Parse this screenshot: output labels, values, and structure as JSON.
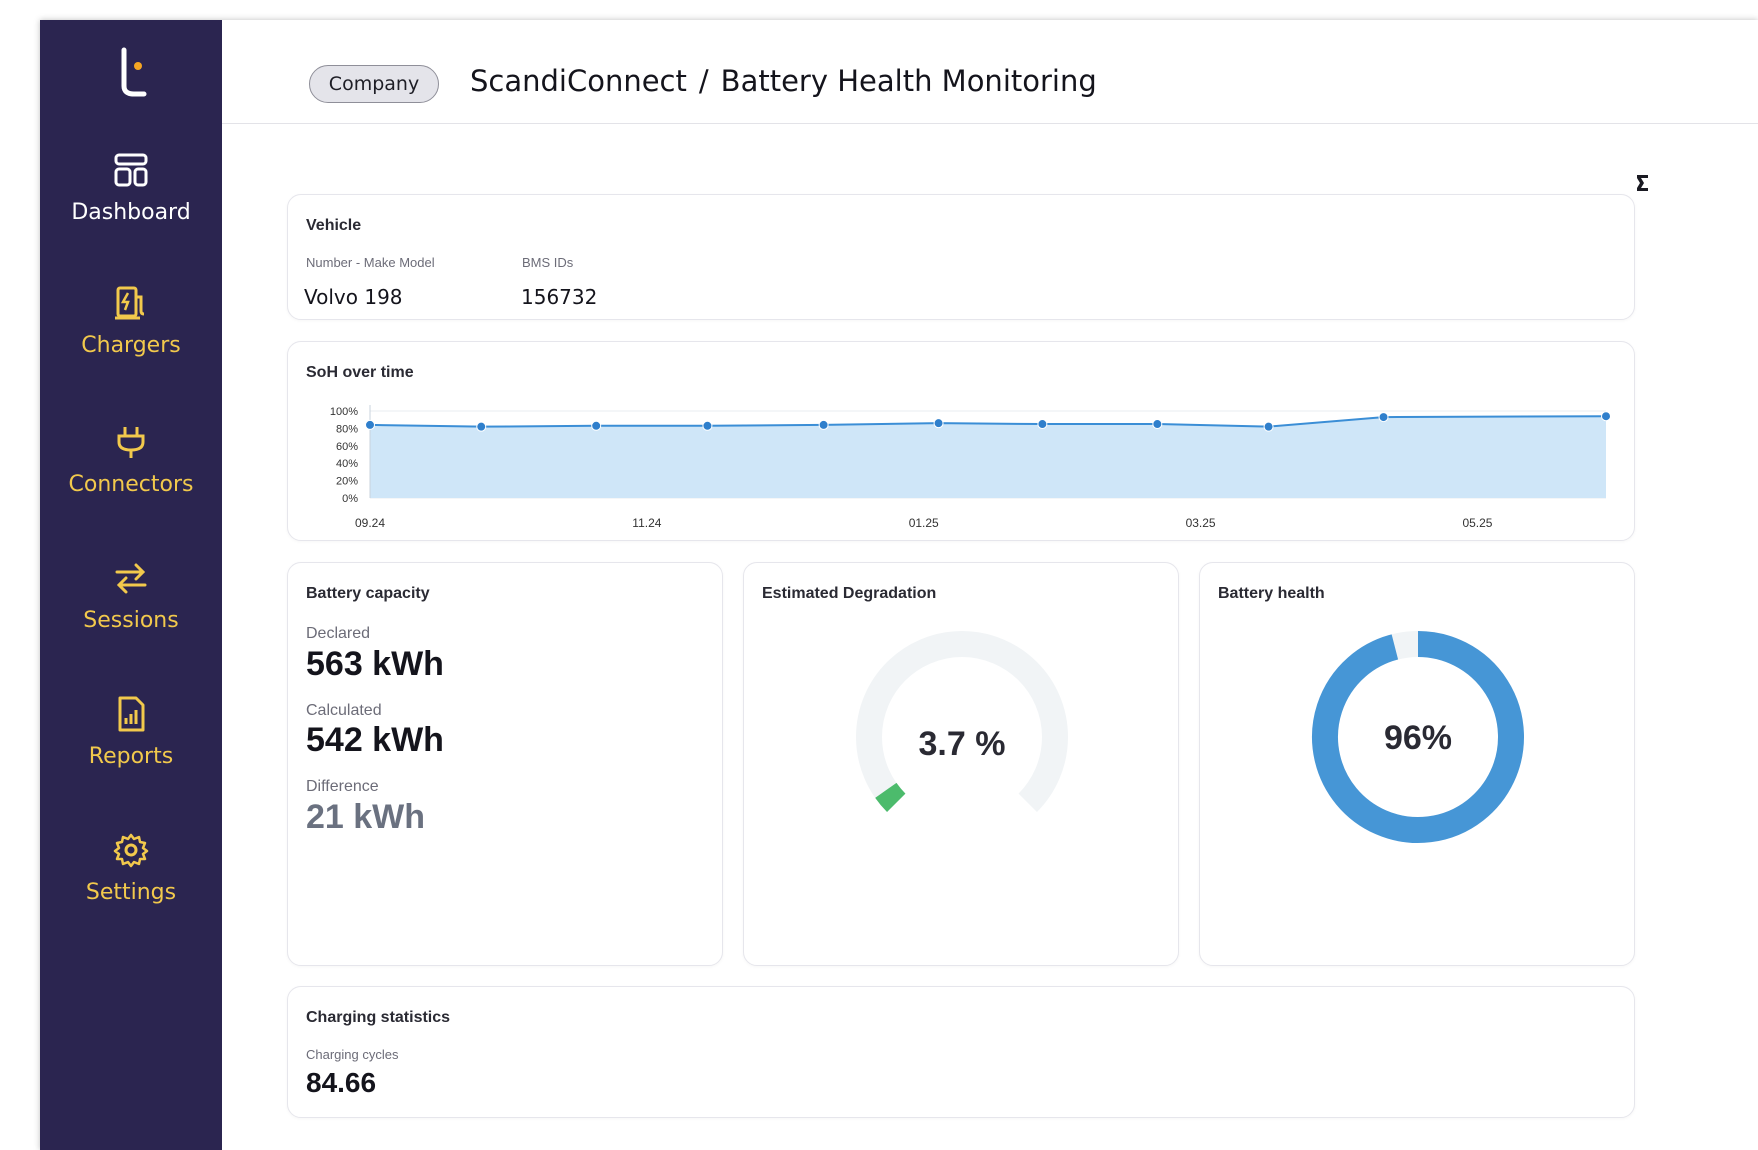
{
  "sidebar": {
    "logo_name": "brand-logo",
    "items": [
      {
        "label": "Dashboard",
        "icon": "dashboard-icon",
        "active": true
      },
      {
        "label": "Chargers",
        "icon": "charger-icon",
        "active": false
      },
      {
        "label": "Connectors",
        "icon": "plug-icon",
        "active": false
      },
      {
        "label": "Sessions",
        "icon": "swap-arrows-icon",
        "active": false
      },
      {
        "label": "Reports",
        "icon": "report-icon",
        "active": false
      },
      {
        "label": "Settings",
        "icon": "gear-icon",
        "active": false
      }
    ]
  },
  "header": {
    "company_pill": "Company",
    "breadcrumb_company": "ScandiConnect",
    "breadcrumb_separator": "/",
    "breadcrumb_page": "Battery Health Monitoring",
    "corner_icon": "export-icon"
  },
  "vehicle": {
    "title": "Vehicle",
    "number_label": "Number - Make Model",
    "number_value": "Volvo 198",
    "bms_label": "BMS IDs",
    "bms_value": "156732"
  },
  "soh": {
    "title": "SoH over time"
  },
  "chart_data": {
    "type": "area",
    "title": "SoH over time",
    "xlabel": "",
    "ylabel": "",
    "x_ticks": [
      "09.24",
      "11.24",
      "01.25",
      "03.25",
      "05.25"
    ],
    "y_ticks": [
      "100%",
      "80%",
      "60%",
      "40%",
      "20%",
      "0%"
    ],
    "ylim": [
      0,
      100
    ],
    "x": [
      0,
      0.9,
      1.83,
      2.73,
      3.67,
      4.6,
      5.44,
      6.37,
      7.27,
      8.2,
      10.0
    ],
    "values": [
      84,
      82,
      83,
      83,
      84,
      86,
      85,
      85,
      82,
      93,
      94
    ],
    "grid": true,
    "colors": {
      "line": "#3b8ed6",
      "fill": "#cfe6f8",
      "point": "#2f7fcc"
    }
  },
  "capacity": {
    "title": "Battery capacity",
    "declared_label": "Declared",
    "declared_value": "563 kWh",
    "calculated_label": "Calculated",
    "calculated_value": "542 kWh",
    "difference_label": "Difference",
    "difference_value": "21 kWh"
  },
  "degradation": {
    "title": "Estimated Degradation",
    "value_text": "3.7 %",
    "value": 3.7,
    "max": 100,
    "color": "#4cbb6c",
    "track_color": "#f1f4f6"
  },
  "health": {
    "title": "Battery health",
    "value_text": "96%",
    "value": 96,
    "color": "#4696d6",
    "track_color": "#f1f4f6"
  },
  "charging": {
    "title": "Charging statistics",
    "cycles_label": "Charging cycles",
    "cycles_value": "84.66"
  },
  "theme": {
    "sidebar_bg": "#2b2550",
    "sidebar_accent": "#f2c94c",
    "logo_dot": "#f5a623"
  }
}
